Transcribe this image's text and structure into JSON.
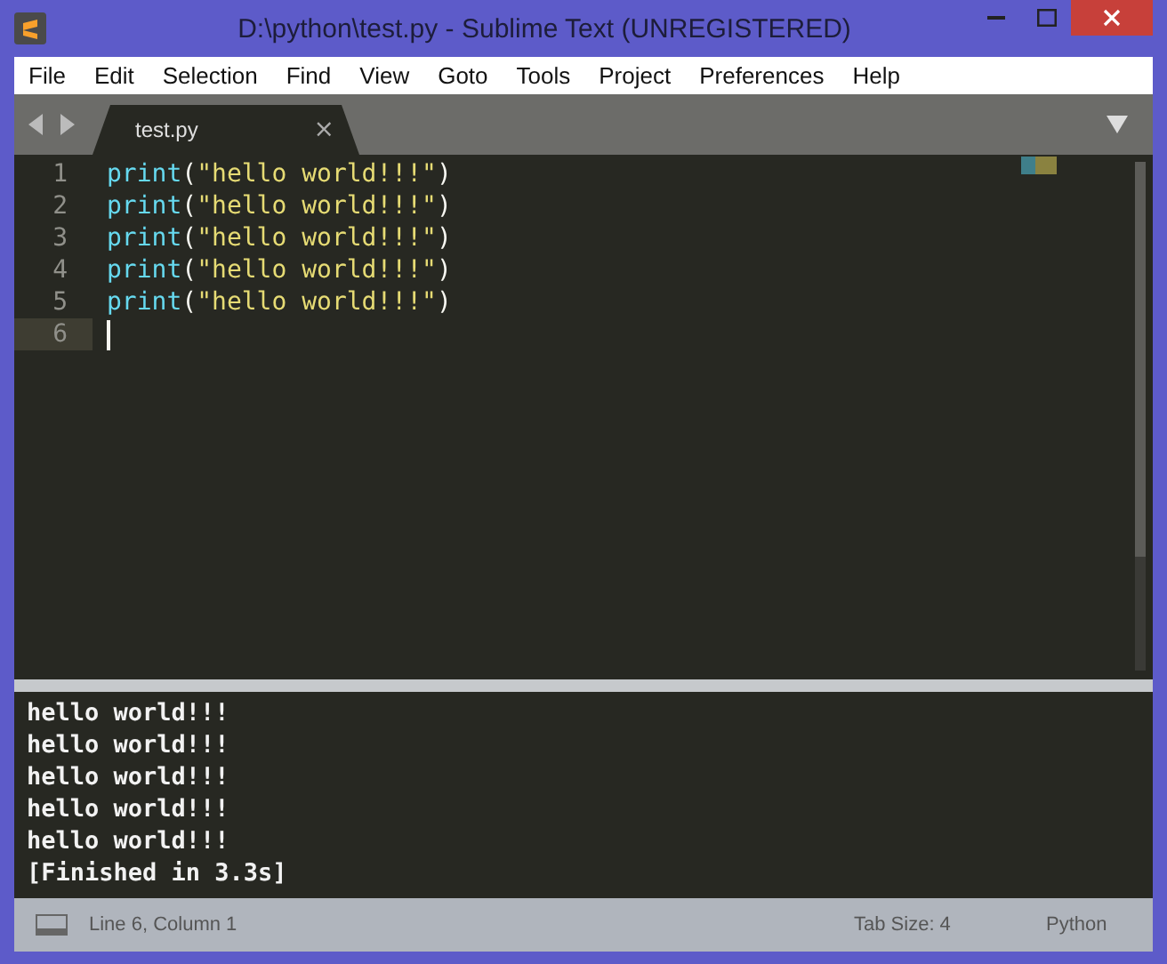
{
  "window": {
    "title": "D:\\python\\test.py - Sublime Text (UNREGISTERED)"
  },
  "menu": [
    "File",
    "Edit",
    "Selection",
    "Find",
    "View",
    "Goto",
    "Tools",
    "Project",
    "Preferences",
    "Help"
  ],
  "tabs": [
    {
      "label": "test.py",
      "selected": true
    }
  ],
  "close_tab": "×",
  "editor": {
    "lines": [
      {
        "number": "1",
        "func": "print",
        "open": "(",
        "string": "\"hello world!!!\"",
        "close": ")",
        "current": false
      },
      {
        "number": "2",
        "func": "print",
        "open": "(",
        "string": "\"hello world!!!\"",
        "close": ")",
        "current": false
      },
      {
        "number": "3",
        "func": "print",
        "open": "(",
        "string": "\"hello world!!!\"",
        "close": ")",
        "current": false
      },
      {
        "number": "4",
        "func": "print",
        "open": "(",
        "string": "\"hello world!!!\"",
        "close": ")",
        "current": false
      },
      {
        "number": "5",
        "func": "print",
        "open": "(",
        "string": "\"hello world!!!\"",
        "close": ")",
        "current": false
      },
      {
        "number": "6",
        "current": true
      }
    ]
  },
  "output": [
    "hello world!!!",
    "hello world!!!",
    "hello world!!!",
    "hello world!!!",
    "hello world!!!",
    "[Finished in 3.3s]"
  ],
  "status_bar": {
    "position": "Line 6, Column 1",
    "tab_size": "Tab Size: 4",
    "syntax": "Python"
  }
}
